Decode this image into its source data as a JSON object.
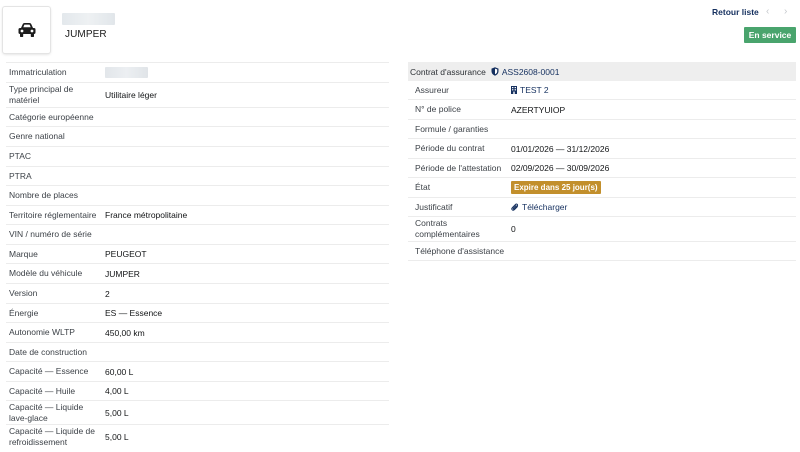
{
  "header": {
    "vehicle_name": "JUMPER",
    "back_label": "Retour liste",
    "prev_glyph": "‹",
    "next_glyph": "›",
    "status": "En service",
    "icon": "car-icon"
  },
  "colors": {
    "status_badge": "#49a46d",
    "warning_badge": "#c28f2c",
    "link": "#15305f"
  },
  "vehicle_fields": [
    {
      "label": "Immatriculation",
      "value": ""
    },
    {
      "label": "Type principal de matériel",
      "value": "Utilitaire léger"
    },
    {
      "label": "Catégorie européenne",
      "value": ""
    },
    {
      "label": "Genre national",
      "value": ""
    },
    {
      "label": "PTAC",
      "value": ""
    },
    {
      "label": "PTRA",
      "value": ""
    },
    {
      "label": "Nombre de places",
      "value": ""
    },
    {
      "label": "Territoire réglementaire",
      "value": "France métropolitaine"
    },
    {
      "label": "VIN / numéro de série",
      "value": ""
    },
    {
      "label": "Marque",
      "value": "PEUGEOT"
    },
    {
      "label": "Modèle du véhicule",
      "value": "JUMPER"
    },
    {
      "label": "Version",
      "value": "2"
    },
    {
      "label": "Énergie",
      "value": "ES — Essence"
    },
    {
      "label": "Autonomie WLTP",
      "value": "450,00 km"
    },
    {
      "label": "Date de construction",
      "value": ""
    },
    {
      "label": "Capacité — Essence",
      "value": "60,00 L"
    },
    {
      "label": "Capacité — Huile",
      "value": "4,00 L"
    },
    {
      "label": "Capacité — Liquide lave-glace",
      "value": "5,00 L"
    },
    {
      "label": "Capacité — Liquide de refroidissement",
      "value": "5,00 L"
    }
  ],
  "insurance": {
    "title": "Contrat d'assurance",
    "reference": "ASS2608-0001",
    "rows": {
      "assureur": {
        "label": "Assureur",
        "value": "TEST 2"
      },
      "police": {
        "label": "N° de police",
        "value": "AZERTYUIOP"
      },
      "formule": {
        "label": "Formule / garanties",
        "value": ""
      },
      "periode_contrat": {
        "label": "Période du contrat",
        "value": "01/01/2026 — 31/12/2026"
      },
      "periode_attestation": {
        "label": "Période de l'attestation",
        "value": "02/09/2026 — 30/09/2026"
      },
      "etat": {
        "label": "État",
        "value": "Expire dans 25 jour(s)"
      },
      "justificatif": {
        "label": "Justificatif",
        "value": "Télécharger"
      },
      "complementaires": {
        "label": "Contrats complémentaires",
        "value": "0"
      },
      "telephone": {
        "label": "Téléphone d'assistance",
        "value": ""
      }
    }
  }
}
